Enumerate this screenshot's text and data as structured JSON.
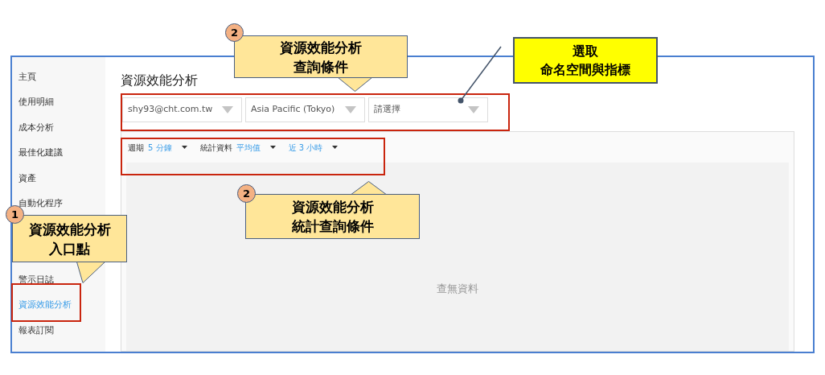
{
  "sidebar": {
    "upper_items": [
      {
        "label": "主頁",
        "selected": false
      },
      {
        "label": "使用明細",
        "selected": false
      },
      {
        "label": "成本分析",
        "selected": false
      },
      {
        "label": "最佳化建議",
        "selected": false
      },
      {
        "label": "資產",
        "selected": false
      },
      {
        "label": "自動化程序",
        "selected": false
      }
    ],
    "lower_items": [
      {
        "label": "警示日誌",
        "selected": false
      },
      {
        "label": "資源效能分析",
        "selected": true
      },
      {
        "label": "報表訂閱",
        "selected": false
      }
    ]
  },
  "page_title": "資源效能分析",
  "selects": [
    {
      "value": "shy93@cht.com.tw"
    },
    {
      "value": "Asia Pacific (Tokyo)"
    },
    {
      "value": "請選擇"
    }
  ],
  "filters": [
    {
      "label": "週期",
      "value": "5 分鐘"
    },
    {
      "label": "統計資料",
      "value": "平均值"
    },
    {
      "value": "近 3 小時"
    }
  ],
  "empty_message": "查無資料",
  "annotations": [
    {
      "kind": "callout",
      "number": "1",
      "lines": [
        "資源效能分析",
        "入口點"
      ]
    },
    {
      "kind": "callout",
      "number": "2",
      "lines": [
        "資源效能分析",
        "查詢條件"
      ]
    },
    {
      "kind": "callout",
      "number": "2",
      "lines": [
        "資源效能分析",
        "統計查詢條件"
      ]
    },
    {
      "kind": "note",
      "lines": [
        "選取",
        "命名空間與指標"
      ]
    }
  ]
}
